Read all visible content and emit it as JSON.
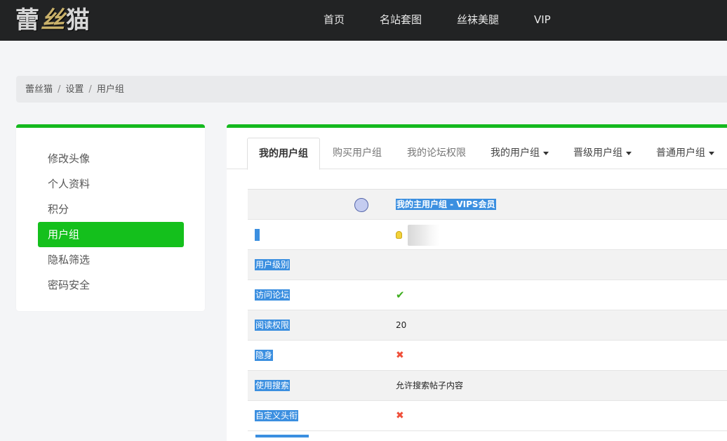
{
  "header": {
    "logo_text": "蕾丝猫",
    "nav": [
      "首页",
      "名站套图",
      "丝袜美腿",
      "VIP"
    ]
  },
  "breadcrumb": [
    "蕾丝猫",
    "设置",
    "用户组"
  ],
  "sidebar": {
    "items": [
      {
        "label": "修改头像",
        "active": false
      },
      {
        "label": "个人资料",
        "active": false
      },
      {
        "label": "积分",
        "active": false
      },
      {
        "label": "用户组",
        "active": true
      },
      {
        "label": "隐私筛选",
        "active": false
      },
      {
        "label": "密码安全",
        "active": false
      }
    ]
  },
  "tabs": [
    {
      "label": "我的用户组",
      "active": true,
      "dropdown": false
    },
    {
      "label": "购买用户组",
      "active": false,
      "dropdown": false
    },
    {
      "label": "我的论坛权限",
      "active": false,
      "dropdown": false
    },
    {
      "label": "我的用户组",
      "active": false,
      "dropdown": true
    },
    {
      "label": "晋级用户组",
      "active": false,
      "dropdown": true
    },
    {
      "label": "普通用户组",
      "active": false,
      "dropdown": true
    }
  ],
  "table": {
    "header": "我的主用户组 - VIPS会员",
    "rows": [
      {
        "label": "用户级别",
        "value": ""
      },
      {
        "label": "访问论坛",
        "value": "✔"
      },
      {
        "label": "阅读权限",
        "value": "20"
      },
      {
        "label": "隐身",
        "value": "✖"
      },
      {
        "label": "使用搜索",
        "value": "允许搜索帖子内容"
      },
      {
        "label": "自定义头衔",
        "value": "✖"
      }
    ]
  },
  "colors": {
    "accent_green": "#14c01c",
    "selection_blue": "#3b8fe0",
    "topbar": "#222324",
    "check_green": "#3fae1f",
    "cross_red": "#ef4f3a"
  },
  "icons": [
    "bulb-icon",
    "check-icon",
    "cross-icon",
    "caret-down-icon"
  ]
}
